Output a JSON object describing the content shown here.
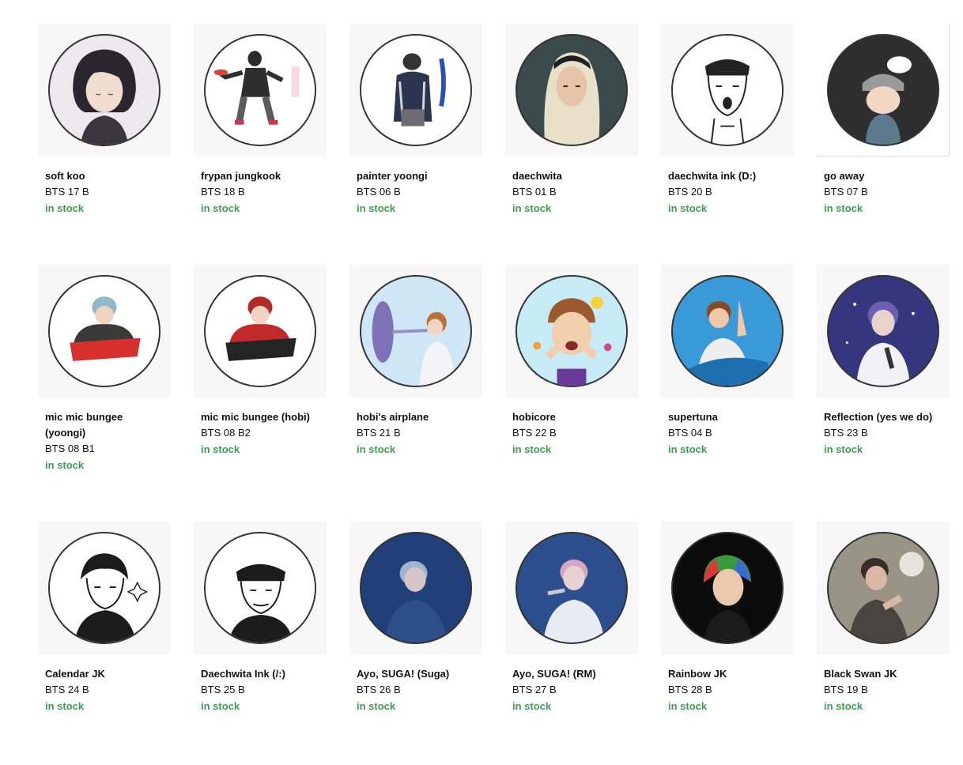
{
  "products": [
    {
      "title": "soft koo",
      "sku": "BTS 17 B",
      "stock": "in stock",
      "art": "dark-hair-portrait",
      "bg": "#c9c6cc"
    },
    {
      "title": "frypan jungkook",
      "sku": "BTS 18 B",
      "stock": "in stock",
      "art": "figure-frypan",
      "bg": "#ffffff"
    },
    {
      "title": "painter yoongi",
      "sku": "BTS 06 B",
      "stock": "in stock",
      "art": "painter-back",
      "bg": "#ffffff"
    },
    {
      "title": "daechwita",
      "sku": "BTS 01 B",
      "stock": "in stock",
      "art": "blonde-portrait",
      "bg": "#2f3a3c"
    },
    {
      "title": "daechwita ink (D:)",
      "sku": "BTS 20 B",
      "stock": "in stock",
      "art": "ink-portrait",
      "bg": "#ffffff"
    },
    {
      "title": "go away",
      "sku": "BTS 07 B",
      "stock": "in stock",
      "art": "beanie-chibi",
      "bg": "#2e2e2e"
    },
    {
      "title": "mic mic bungee (yoongi)",
      "sku": "BTS 08 B1",
      "stock": "in stock",
      "art": "mic-mic-yoongi",
      "bg": "#ffffff"
    },
    {
      "title": "mic mic bungee (hobi)",
      "sku": "BTS 08 B2",
      "stock": "in stock",
      "art": "mic-mic-hobi",
      "bg": "#ffffff"
    },
    {
      "title": "hobi's airplane",
      "sku": "BTS 21 B",
      "stock": "in stock",
      "art": "airplane",
      "bg": "#bcd9ef"
    },
    {
      "title": "hobicore",
      "sku": "BTS 22 B",
      "stock": "in stock",
      "art": "hobicore",
      "bg": "#b9e3f3"
    },
    {
      "title": "supertuna",
      "sku": "BTS 04 B",
      "stock": "in stock",
      "art": "supertuna",
      "bg": "#2f8fd0"
    },
    {
      "title": "Reflection (yes we do)",
      "sku": "BTS 23 B",
      "stock": "in stock",
      "art": "reflection",
      "bg": "#3a3c8c"
    },
    {
      "title": "Calendar JK",
      "sku": "BTS 24 B",
      "stock": "in stock",
      "art": "calendar-ink",
      "bg": "#ffffff"
    },
    {
      "title": "Daechwita Ink (/:)",
      "sku": "BTS 25 B",
      "stock": "in stock",
      "art": "headband-ink",
      "bg": "#ffffff"
    },
    {
      "title": "Ayo, SUGA! (Suga)",
      "sku": "BTS 26 B",
      "stock": "in stock",
      "art": "stage-suga",
      "bg": "#1f3d73"
    },
    {
      "title": "Ayo, SUGA! (RM)",
      "sku": "BTS 27 B",
      "stock": "in stock",
      "art": "stage-rm",
      "bg": "#2a4a86"
    },
    {
      "title": "Rainbow JK",
      "sku": "BTS 28 B",
      "stock": "in stock",
      "art": "rainbow-hair",
      "bg": "#0b0b0b"
    },
    {
      "title": "Black Swan JK",
      "sku": "BTS 19 B",
      "stock": "in stock",
      "art": "black-swan",
      "bg": "#8a8478"
    }
  ],
  "colors": {
    "stock_green": "#3d9e52"
  }
}
